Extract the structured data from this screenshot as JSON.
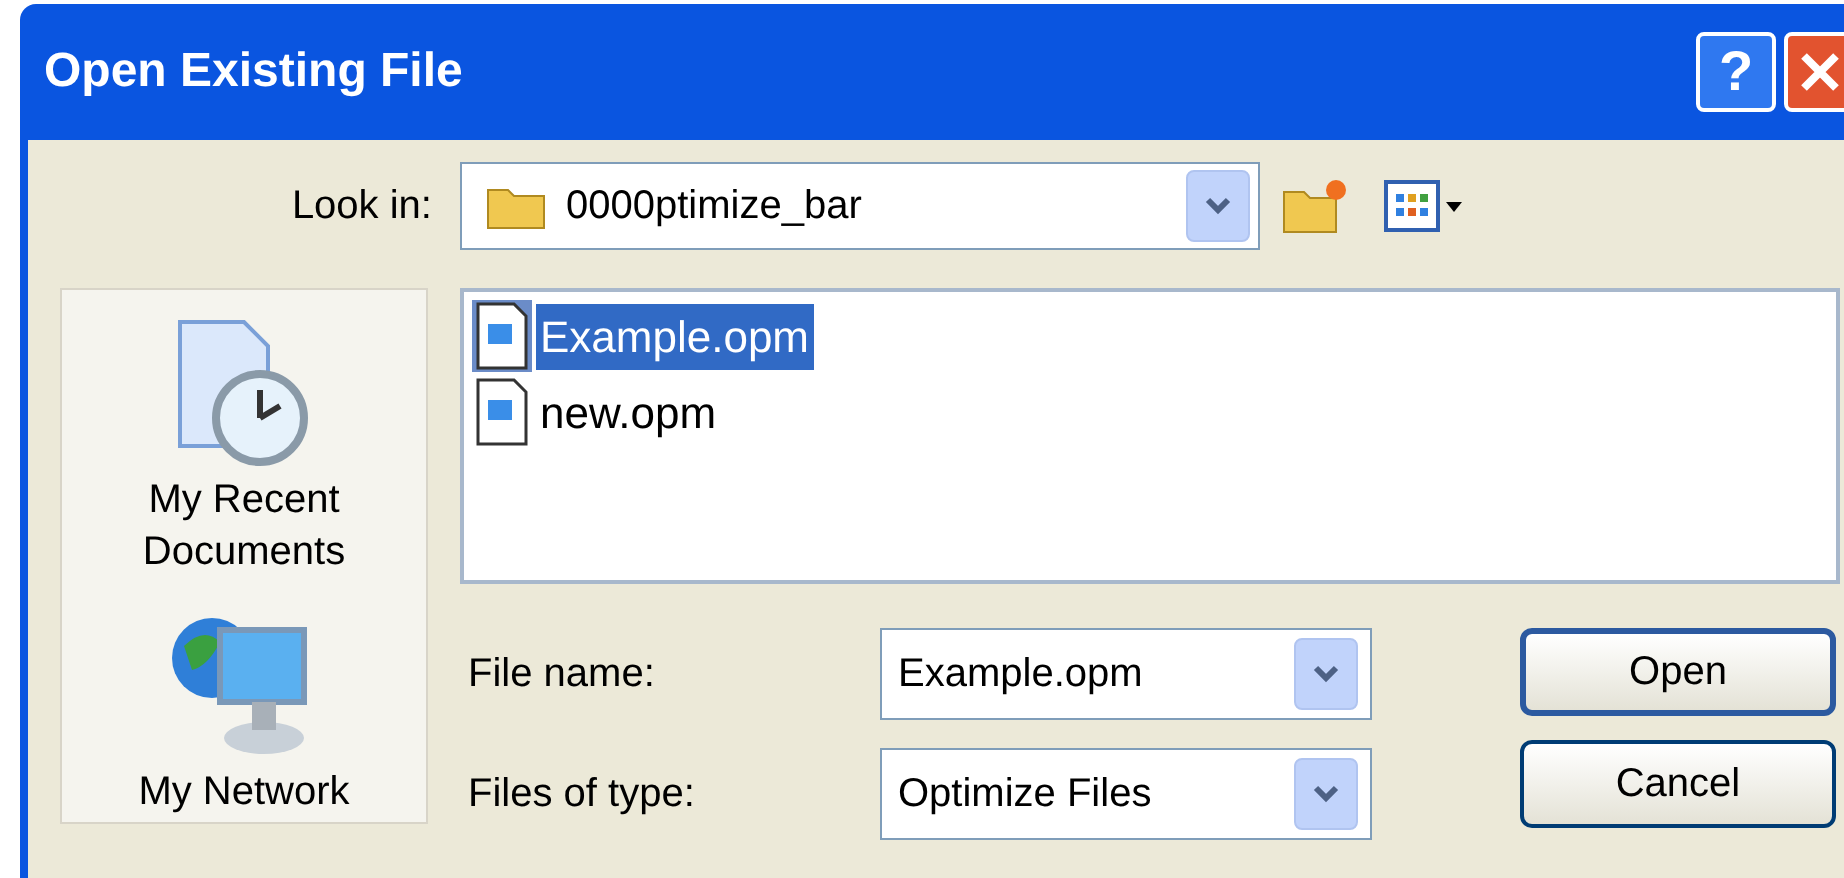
{
  "window": {
    "title": "Open Existing File"
  },
  "title_buttons": [
    {
      "kind": "help",
      "label": "?"
    },
    {
      "kind": "close"
    }
  ],
  "look_in": {
    "label": "Look in:",
    "value": "0000ptimize_bar"
  },
  "places": [
    {
      "kind": "recent",
      "label": "My Recent Documents"
    },
    {
      "kind": "network",
      "label": "My Network"
    }
  ],
  "files": [
    {
      "name": "Example.opm",
      "selected": true
    },
    {
      "name": "new.opm",
      "selected": false
    }
  ],
  "file_name": {
    "label": "File name:",
    "value": "Example.opm"
  },
  "file_type": {
    "label": "Files of type:",
    "value": "Optimize Files"
  },
  "buttons": [
    {
      "label": "Open",
      "kind": "default"
    },
    {
      "label": "Cancel",
      "kind": "normal"
    }
  ]
}
